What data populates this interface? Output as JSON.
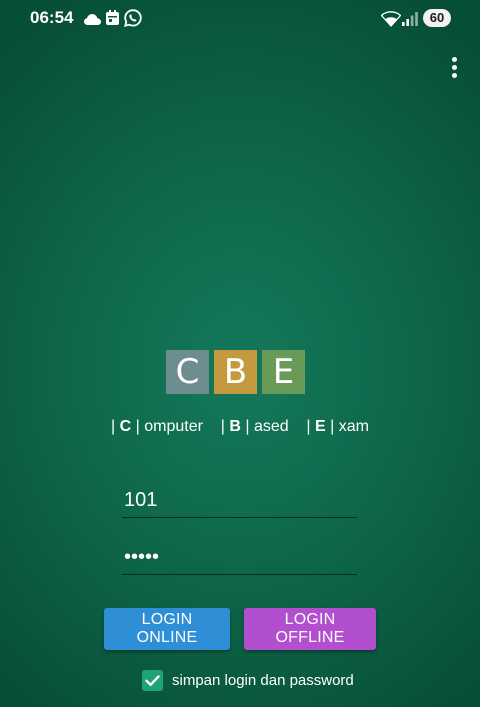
{
  "status_bar": {
    "time": "06:54",
    "battery": "60",
    "icons": [
      "cloud-icon",
      "calendar-icon",
      "whatsapp-icon",
      "wifi-icon",
      "signal-icon",
      "battery-icon"
    ]
  },
  "menu": {
    "icon": "more-vertical-icon"
  },
  "logo": {
    "tiles": [
      {
        "letter": "C",
        "color": "#6e8d91"
      },
      {
        "letter": "B",
        "color": "#c39a3e"
      },
      {
        "letter": "E",
        "color": "#6a9a57"
      }
    ]
  },
  "tagline": {
    "c_letter": "C",
    "c_rest": "omputer",
    "b_letter": "B",
    "b_rest": "ased",
    "e_letter": "E",
    "e_rest": "xam",
    "separator": "|"
  },
  "form": {
    "username_value": "101",
    "password_value": "•••••"
  },
  "buttons": {
    "online": "LOGIN ONLINE",
    "offline": "LOGIN OFFLINE"
  },
  "remember": {
    "checked": true,
    "label": "simpan login dan password",
    "accent": "#21a37a"
  },
  "colors": {
    "background": "#0f6a4d",
    "online_button": "#2f8fd6",
    "offline_button": "#b14fcf"
  }
}
